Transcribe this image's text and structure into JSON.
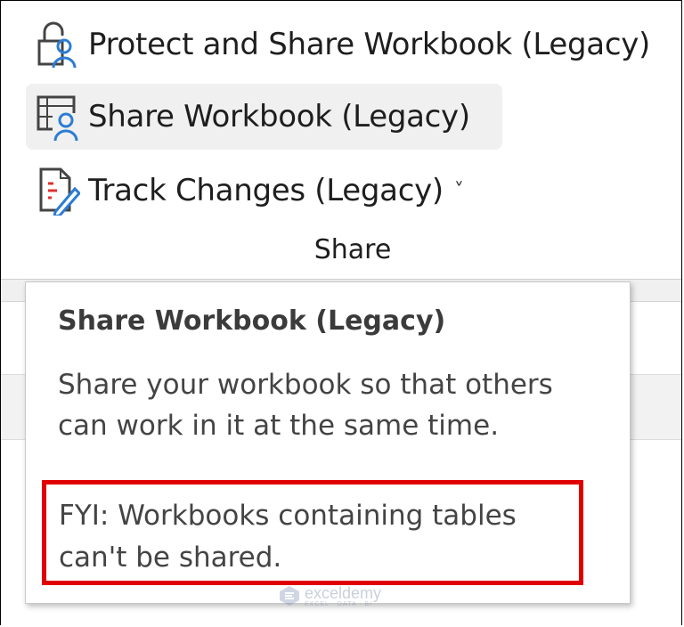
{
  "ribbon": {
    "commands": [
      {
        "label": "Protect and Share Workbook (Legacy)",
        "icon": "protect-share-workbook-icon"
      },
      {
        "label": "Share Workbook (Legacy)",
        "icon": "share-workbook-icon",
        "state": "hover"
      },
      {
        "label": "Track Changes (Legacy)",
        "icon": "track-changes-icon",
        "dropdown": "˅"
      }
    ],
    "group_label": "Share"
  },
  "tooltip": {
    "title": "Share Workbook (Legacy)",
    "description": "Share your workbook so that others can work in it at the same time.",
    "fyi": "FYI: Workbooks containing tables can't be shared.",
    "highlight_color": "#e00000"
  },
  "watermark": {
    "name": "exceldemy",
    "tagline": "EXCEL · DATA · BI"
  },
  "colors": {
    "icon_blue": "#2b7cd3",
    "icon_gray": "#444444",
    "hover_bg": "#f0f0f0"
  }
}
